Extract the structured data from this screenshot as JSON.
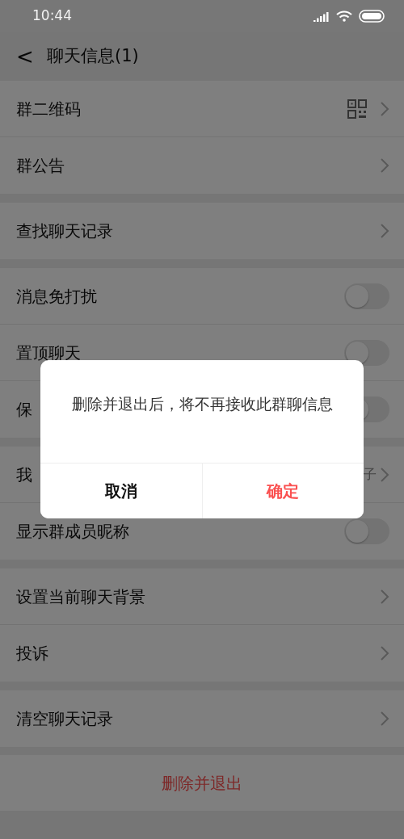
{
  "status_bar": {
    "time": "10:44"
  },
  "header": {
    "back": "<",
    "title": "聊天信息(1)"
  },
  "sections": [
    {
      "rows": [
        {
          "kind": "qr",
          "label": "群二维码"
        },
        {
          "kind": "link",
          "label": "群公告"
        }
      ]
    },
    {
      "rows": [
        {
          "kind": "link",
          "label": "查找聊天记录"
        }
      ]
    },
    {
      "rows": [
        {
          "kind": "toggle",
          "label": "消息免打扰",
          "on": false
        },
        {
          "kind": "toggle",
          "label": "置顶聊天",
          "on": false
        },
        {
          "kind": "toggle",
          "label": "保",
          "on": false
        }
      ]
    },
    {
      "rows": [
        {
          "kind": "value",
          "label": "我",
          "value": "子"
        },
        {
          "kind": "toggle",
          "label": "显示群成员昵称",
          "on": false
        }
      ]
    },
    {
      "rows": [
        {
          "kind": "link",
          "label": "设置当前聊天背景"
        },
        {
          "kind": "link",
          "label": "投诉"
        }
      ]
    },
    {
      "rows": [
        {
          "kind": "link",
          "label": "清空聊天记录"
        }
      ]
    }
  ],
  "danger_button": "删除并退出",
  "dialog": {
    "message": "删除并退出后，将不再接收此群聊信息",
    "buttons": [
      {
        "label": "取消",
        "kind": "cancel"
      },
      {
        "label": "确定",
        "kind": "confirm"
      }
    ]
  }
}
